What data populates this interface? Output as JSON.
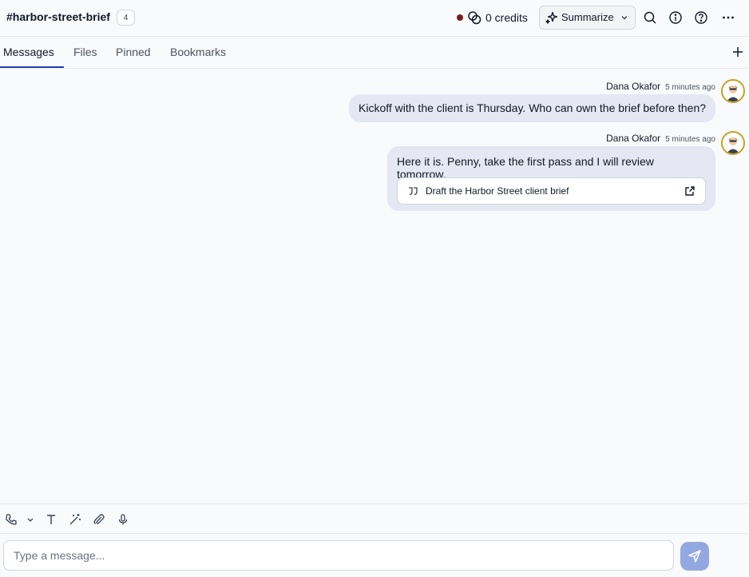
{
  "header": {
    "channel": "#harbor-street-brief",
    "member_count": "4",
    "credits": "0 credits",
    "summarize_label": "Summarize"
  },
  "tabs": [
    {
      "label": "Messages",
      "active": true
    },
    {
      "label": "Files"
    },
    {
      "label": "Pinned"
    },
    {
      "label": "Bookmarks"
    }
  ],
  "messages": [
    {
      "author": "Dana Okafor",
      "time": "5 minutes ago",
      "text": "Kickoff with the client is Thursday. Who can own the brief before then?"
    },
    {
      "author": "Dana Okafor",
      "time": "5 minutes ago",
      "text": "Here it is. Penny, take the first pass and I will review tomorrow.",
      "attachment": "Draft the Harbor Street client brief"
    }
  ],
  "composer": {
    "placeholder": "Type a message..."
  },
  "colors": {
    "accent": "#1e40af",
    "status_dot": "#7f1d1d",
    "bubble": "#e5e7f2",
    "send_button": "#93a8e0",
    "avatar_ring": "#c9a227"
  }
}
